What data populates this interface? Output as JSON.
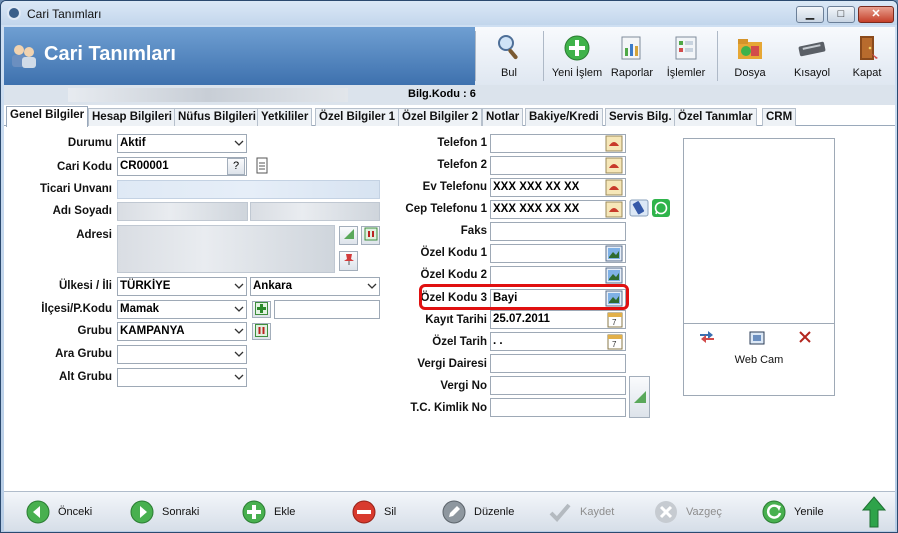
{
  "window": {
    "title": "Cari Tanımları",
    "min": "▁",
    "max": "□",
    "close": "✕"
  },
  "header": {
    "title": "Cari Tanımları"
  },
  "toolbar": {
    "bul": "Bul",
    "yeni": "Yeni İşlem",
    "raporlar": "Raporlar",
    "islemler": "İşlemler",
    "dosya": "Dosya",
    "kisayol": "Kısayol",
    "kapat": "Kapat"
  },
  "info": {
    "bilg_kodu": "Bilg.Kodu : 6"
  },
  "tabs": [
    "Genel Bilgiler",
    "Hesap Bilgileri",
    "Nüfus Bilgileri",
    "Yetkililer",
    "Özel Bilgiler 1",
    "Özel Bilgiler 2",
    "Notlar",
    "Bakiye/Kredi",
    "Servis Bilg.",
    "Özel Tanımlar",
    "CRM"
  ],
  "left": {
    "durumu": {
      "label": "Durumu",
      "value": "Aktif"
    },
    "cari_kodu": {
      "label": "Cari Kodu",
      "value": "CR00001",
      "help": "?"
    },
    "ticari_unvani": {
      "label": "Ticari Unvanı"
    },
    "adi_soyadi": {
      "label": "Adı Soyadı"
    },
    "adresi": {
      "label": "Adresi"
    },
    "ulke_il": {
      "label": "Ülkesi / İli",
      "ulke": "TÜRKİYE",
      "il": "Ankara"
    },
    "ilce_pk": {
      "label": "İlçesi/P.Kodu",
      "ilce": "Mamak"
    },
    "grubu": {
      "label": "Grubu",
      "value": "KAMPANYA"
    },
    "ara_grubu": {
      "label": "Ara Grubu",
      "value": ""
    },
    "alt_grubu": {
      "label": "Alt Grubu",
      "value": ""
    }
  },
  "right": {
    "telefon1": {
      "label": "Telefon 1",
      "value": ""
    },
    "telefon2": {
      "label": "Telefon 2",
      "value": ""
    },
    "ev_tel": {
      "label": "Ev Telefonu",
      "value": "XXX XXX XX XX"
    },
    "cep_tel": {
      "label": "Cep Telefonu 1",
      "value": "XXX XXX XX XX"
    },
    "faks": {
      "label": "Faks",
      "value": ""
    },
    "ozel1": {
      "label": "Özel Kodu 1",
      "value": ""
    },
    "ozel2": {
      "label": "Özel Kodu 2",
      "value": ""
    },
    "ozel3": {
      "label": "Özel Kodu 3",
      "value": "Bayi"
    },
    "kayit": {
      "label": "Kayıt Tarihi",
      "value": "25.07.2011"
    },
    "ozel_tarih": {
      "label": "Özel Tarih",
      "value": " . ."
    },
    "vergi_dairesi": {
      "label": "Vergi Dairesi",
      "value": ""
    },
    "vergi_no": {
      "label": "Vergi No",
      "value": ""
    },
    "tc": {
      "label": "T.C. Kimlik No",
      "value": ""
    }
  },
  "photo": {
    "webcam": "Web Cam"
  },
  "footer": {
    "onceki": "Önceki",
    "sonraki": "Sonraki",
    "ekle": "Ekle",
    "sil": "Sil",
    "duzenle": "Düzenle",
    "kaydet": "Kaydet",
    "vazgec": "Vazgeç",
    "yenile": "Yenile"
  }
}
